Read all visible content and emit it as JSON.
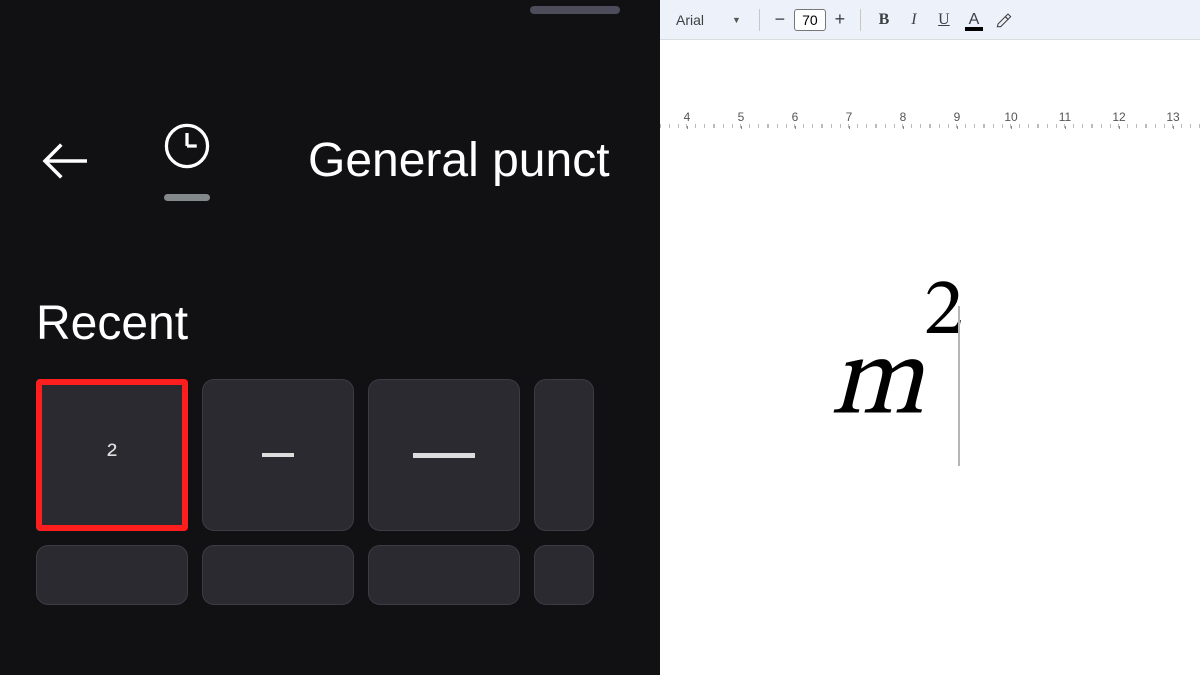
{
  "picker": {
    "category_label": "General punct",
    "recent_label": "Recent",
    "keys": [
      "²",
      "–",
      "—"
    ],
    "highlight_index": 0
  },
  "docs": {
    "toolbar": {
      "font_name": "Arial",
      "font_size": "70",
      "minus": "−",
      "plus": "+",
      "bold": "B",
      "italic": "I",
      "underline": "U",
      "text_color": "A"
    },
    "ruler": {
      "start": 4,
      "end": 13
    },
    "content": {
      "base": "m",
      "exponent": "2"
    }
  }
}
